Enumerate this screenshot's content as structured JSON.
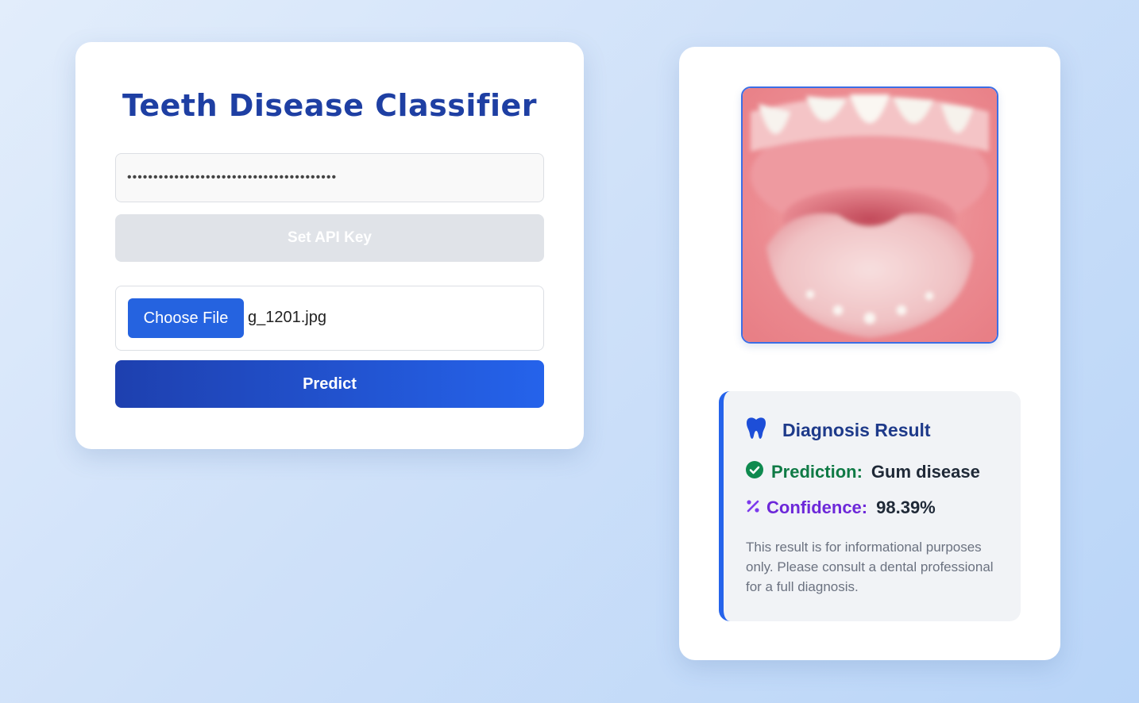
{
  "app": {
    "title": "Teeth Disease Classifier"
  },
  "api": {
    "masked_value": "••••••••••••••••••••••••••••••••••••••••",
    "set_key_label": "Set API Key"
  },
  "upload": {
    "choose_label": "Choose File",
    "file_name": "g_1201.jpg"
  },
  "predict_label": "Predict",
  "result": {
    "title": "Diagnosis Result",
    "prediction_label": "Prediction:",
    "prediction_value": "Gum disease",
    "confidence_label": "Confidence:",
    "confidence_value": "98.39%",
    "note": "This result is for informational purposes only. Please consult a dental professional for a full diagnosis."
  },
  "icons": {
    "title": "tooth-icon",
    "prediction": "check-circle-icon",
    "confidence": "percent-icon"
  },
  "colors": {
    "accent": "#2563eb",
    "title": "#1e3fa3",
    "prediction": "#0f7a45",
    "confidence": "#6d28d9"
  }
}
